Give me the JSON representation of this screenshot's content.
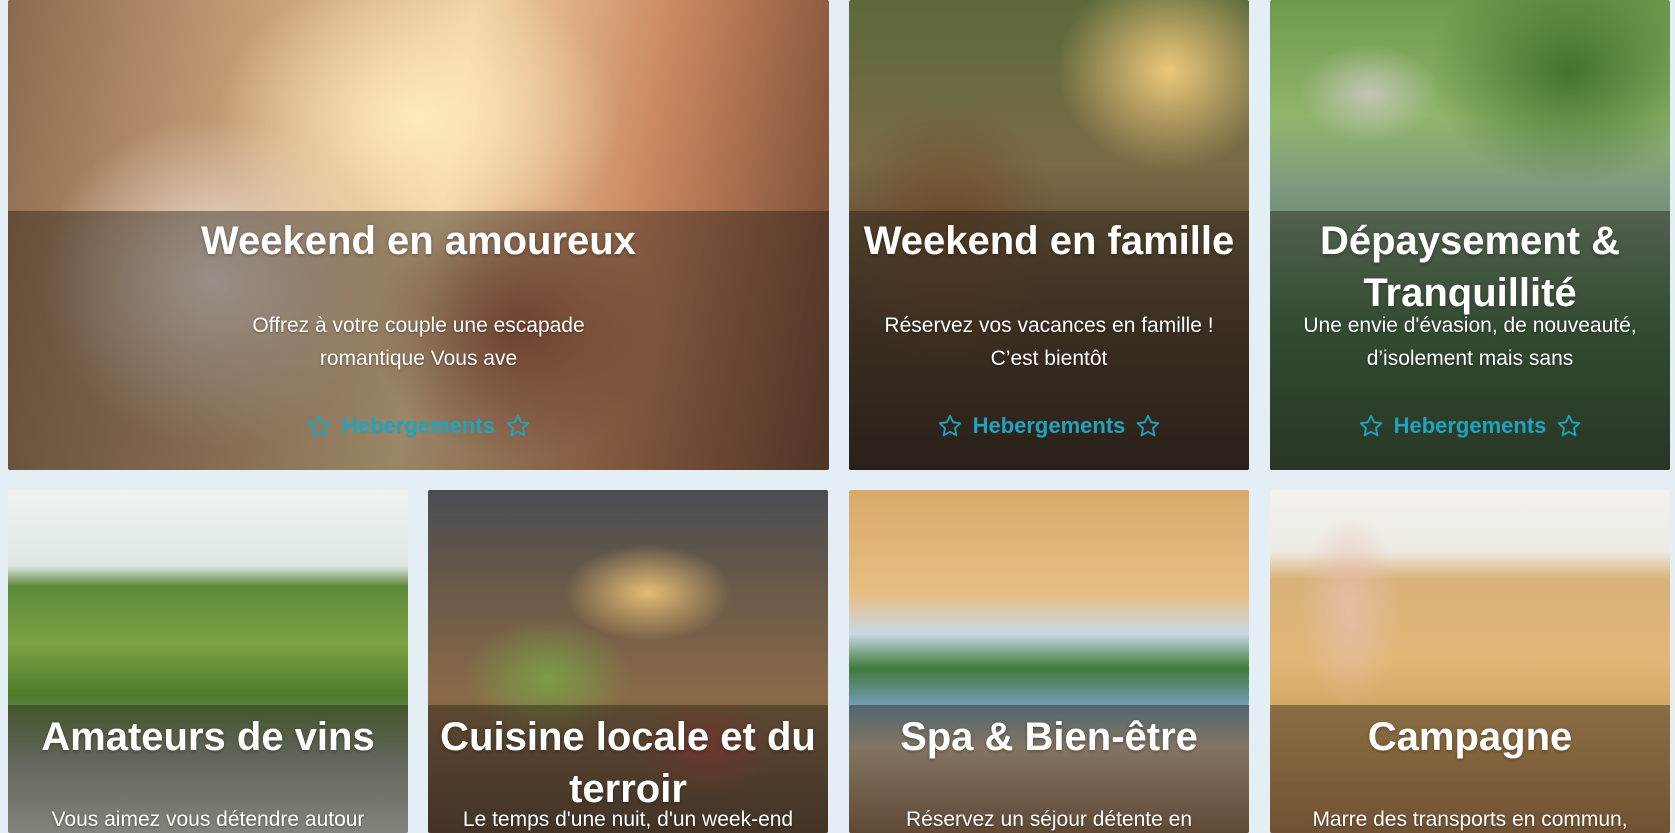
{
  "colors": {
    "page_background": "#e4eef5",
    "accent": "#1fa3bf"
  },
  "icons": {
    "cta": "star-outline-icon"
  },
  "cards": [
    {
      "title": "Weekend en amoureux",
      "description": "Offrez à votre couple une escapade romantique Vous ave",
      "cta_label": "Hebergements"
    },
    {
      "title": "Weekend en famille",
      "description": "Réservez vos vacances en famille ! C’est bientôt",
      "cta_label": "Hebergements"
    },
    {
      "title": "Dépaysement & Tranquillité",
      "description": "Une envie d'évasion, de nouveauté, d’isolement mais sans",
      "cta_label": "Hebergements"
    },
    {
      "title": "Amateurs de vins",
      "description": "Vous aimez vous détendre autour"
    },
    {
      "title": "Cuisine locale et du terroir",
      "description": "Le temps d'une nuit, d'un week-end"
    },
    {
      "title": "Spa & Bien-être",
      "description": "Réservez un séjour détente en"
    },
    {
      "title": "Campagne",
      "description": "Marre des transports en commun,"
    }
  ]
}
